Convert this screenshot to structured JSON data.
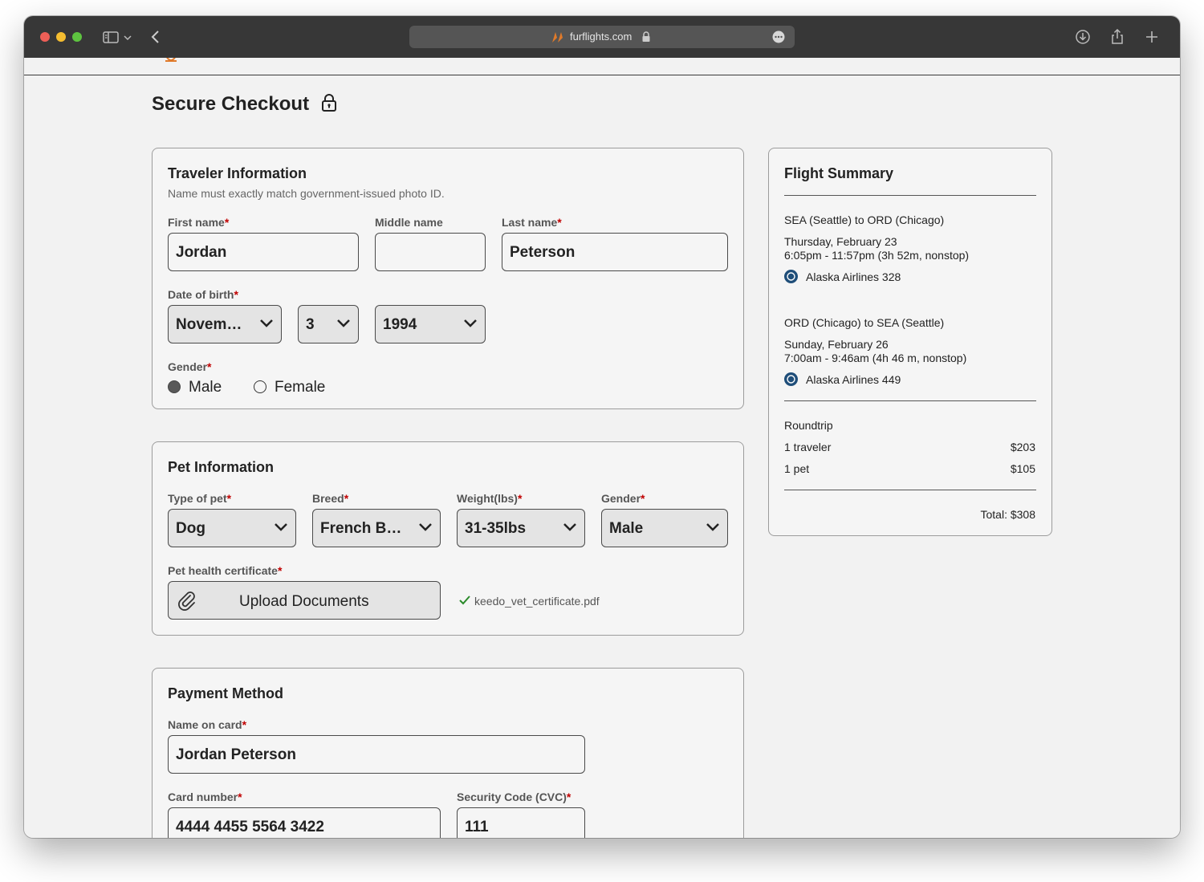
{
  "browser": {
    "url": "furflights.com",
    "colors": {
      "titlebar": "#373737",
      "close": "#ee5f57",
      "minimize": "#f5bd30",
      "zoom": "#5ec440"
    }
  },
  "page": {
    "title": "Secure Checkout"
  },
  "traveler": {
    "title": "Traveler Information",
    "hint": "Name must exactly match government-issued photo ID.",
    "first_name_label": "First name",
    "middle_name_label": "Middle name",
    "last_name_label": "Last name",
    "first_name": "Jordan",
    "middle_name": "",
    "last_name": "Peterson",
    "dob_label": "Date of birth",
    "dob_month": "November",
    "dob_day": "3",
    "dob_year": "1994",
    "gender_label": "Gender",
    "gender_options": [
      "Male",
      "Female"
    ],
    "gender_selected": "Male"
  },
  "pet": {
    "title": "Pet Information",
    "type_label": "Type of pet",
    "breed_label": "Breed",
    "weight_label": "Weight(lbs)",
    "gender_label": "Gender",
    "type": "Dog",
    "breed": "French Bull...",
    "weight": "31-35lbs",
    "gender": "Male",
    "cert_label": "Pet health certificate",
    "upload_label": "Upload Documents",
    "uploaded_file": "keedo_vet_certificate.pdf"
  },
  "payment": {
    "title": "Payment Method",
    "name_label": "Name on card",
    "name": "Jordan Peterson",
    "card_label": "Card number",
    "card": "4444 4455 5564 3422",
    "cvc_label": "Security Code (CVC)",
    "cvc": "111"
  },
  "summary": {
    "title": "Flight Summary",
    "outbound": {
      "route": "SEA (Seattle) to ORD (Chicago)",
      "date": "Thursday, February 23",
      "time": "6:05pm - 11:57pm (3h 52m, nonstop)",
      "airline": "Alaska Airlines 328"
    },
    "return": {
      "route": "ORD (Chicago) to SEA (Seattle)",
      "date": "Sunday, February 26",
      "time": "7:00am - 9:46am (4h 46 m, nonstop)",
      "airline": "Alaska Airlines 449"
    },
    "trip_type": "Roundtrip",
    "traveler_label": "1 traveler",
    "traveler_price": "$203",
    "pet_label": "1 pet",
    "pet_price": "$105",
    "total": "Total: $308"
  }
}
